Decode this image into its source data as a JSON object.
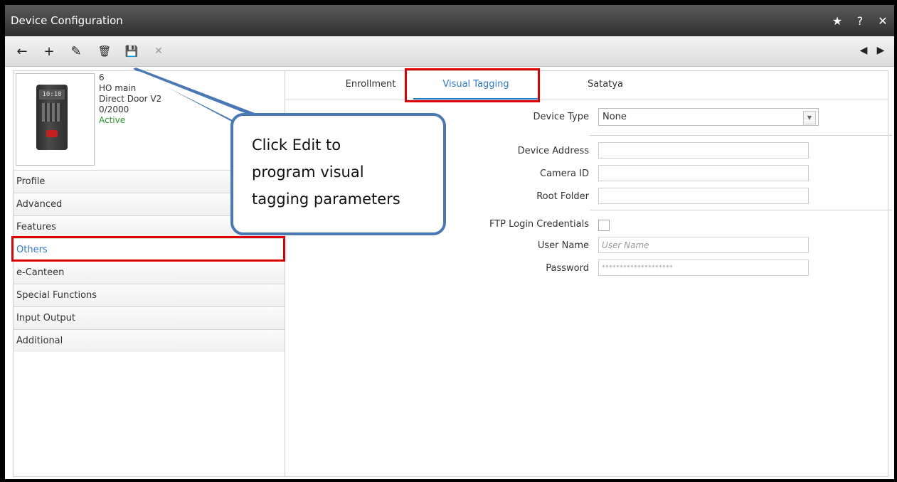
{
  "window": {
    "title": "Device Configuration",
    "controls": {
      "favorite": "★",
      "help": "?",
      "close": "✕"
    }
  },
  "toolbar": {
    "back": "←",
    "add": "+",
    "edit": "✎",
    "delete": "🗑",
    "save": "💾",
    "cancel": "✕",
    "prev": "◀",
    "next": "▶"
  },
  "device": {
    "id": "6",
    "name": "HO main",
    "model": "Direct Door V2",
    "usage": "0/2000",
    "status": "Active",
    "screen_time": "10:10"
  },
  "sidebar": {
    "items": [
      {
        "label": "Profile"
      },
      {
        "label": "Advanced"
      },
      {
        "label": "Features"
      },
      {
        "label": "Others"
      },
      {
        "label": "e-Canteen"
      },
      {
        "label": "Special Functions"
      },
      {
        "label": "Input Output"
      },
      {
        "label": "Additional"
      }
    ],
    "selected": "Others"
  },
  "tabs": [
    {
      "label": "Enrollment"
    },
    {
      "label": "Visual Tagging"
    },
    {
      "label": "Satatya"
    }
  ],
  "form": {
    "device_type_label": "Device Type",
    "device_type_value": "None",
    "device_address_label": "Device Address",
    "camera_id_label": "Camera ID",
    "root_folder_label": "Root Folder",
    "ftp_label": "FTP Login Credentials",
    "username_label": "User Name",
    "username_placeholder": "User Name",
    "password_label": "Password",
    "password_value": "********************"
  },
  "callout": {
    "line1": "Click Edit to",
    "line2": "program visual",
    "line3": "tagging parameters"
  },
  "colors": {
    "accent": "#2f7ad1",
    "highlight": "#e00000",
    "callout_border": "#4a78b5",
    "active_status": "#2e9a2e"
  }
}
